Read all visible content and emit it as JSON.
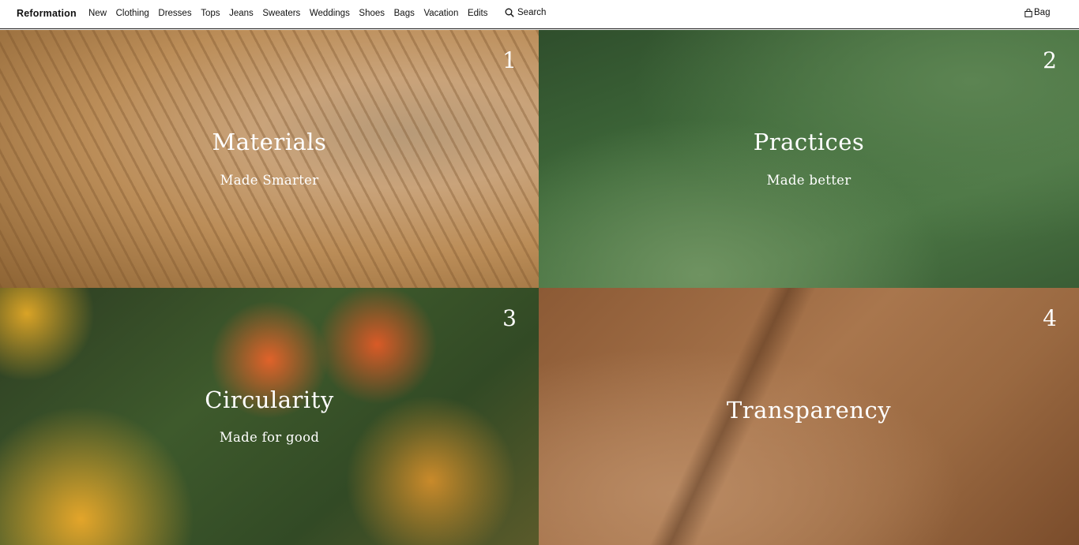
{
  "header": {
    "logo": "Reformation",
    "nav": [
      "New",
      "Clothing",
      "Dresses",
      "Tops",
      "Jeans",
      "Sweaters",
      "Weddings",
      "Shoes",
      "Bags",
      "Vacation",
      "Edits"
    ],
    "search_label": "Search",
    "bag_label": "Bag"
  },
  "tiles": [
    {
      "number": "1",
      "title": "Materials",
      "subtitle": "Made Smarter"
    },
    {
      "number": "2",
      "title": "Practices",
      "subtitle": "Made better"
    },
    {
      "number": "3",
      "title": "Circularity",
      "subtitle": "Made for good"
    },
    {
      "number": "4",
      "title": "Transparency",
      "subtitle": ""
    }
  ],
  "colors": {
    "header_bg": "#ffffff",
    "text_dark": "#111111",
    "overlay_text": "#ffffff"
  },
  "icons": [
    "search-icon",
    "bag-icon"
  ]
}
